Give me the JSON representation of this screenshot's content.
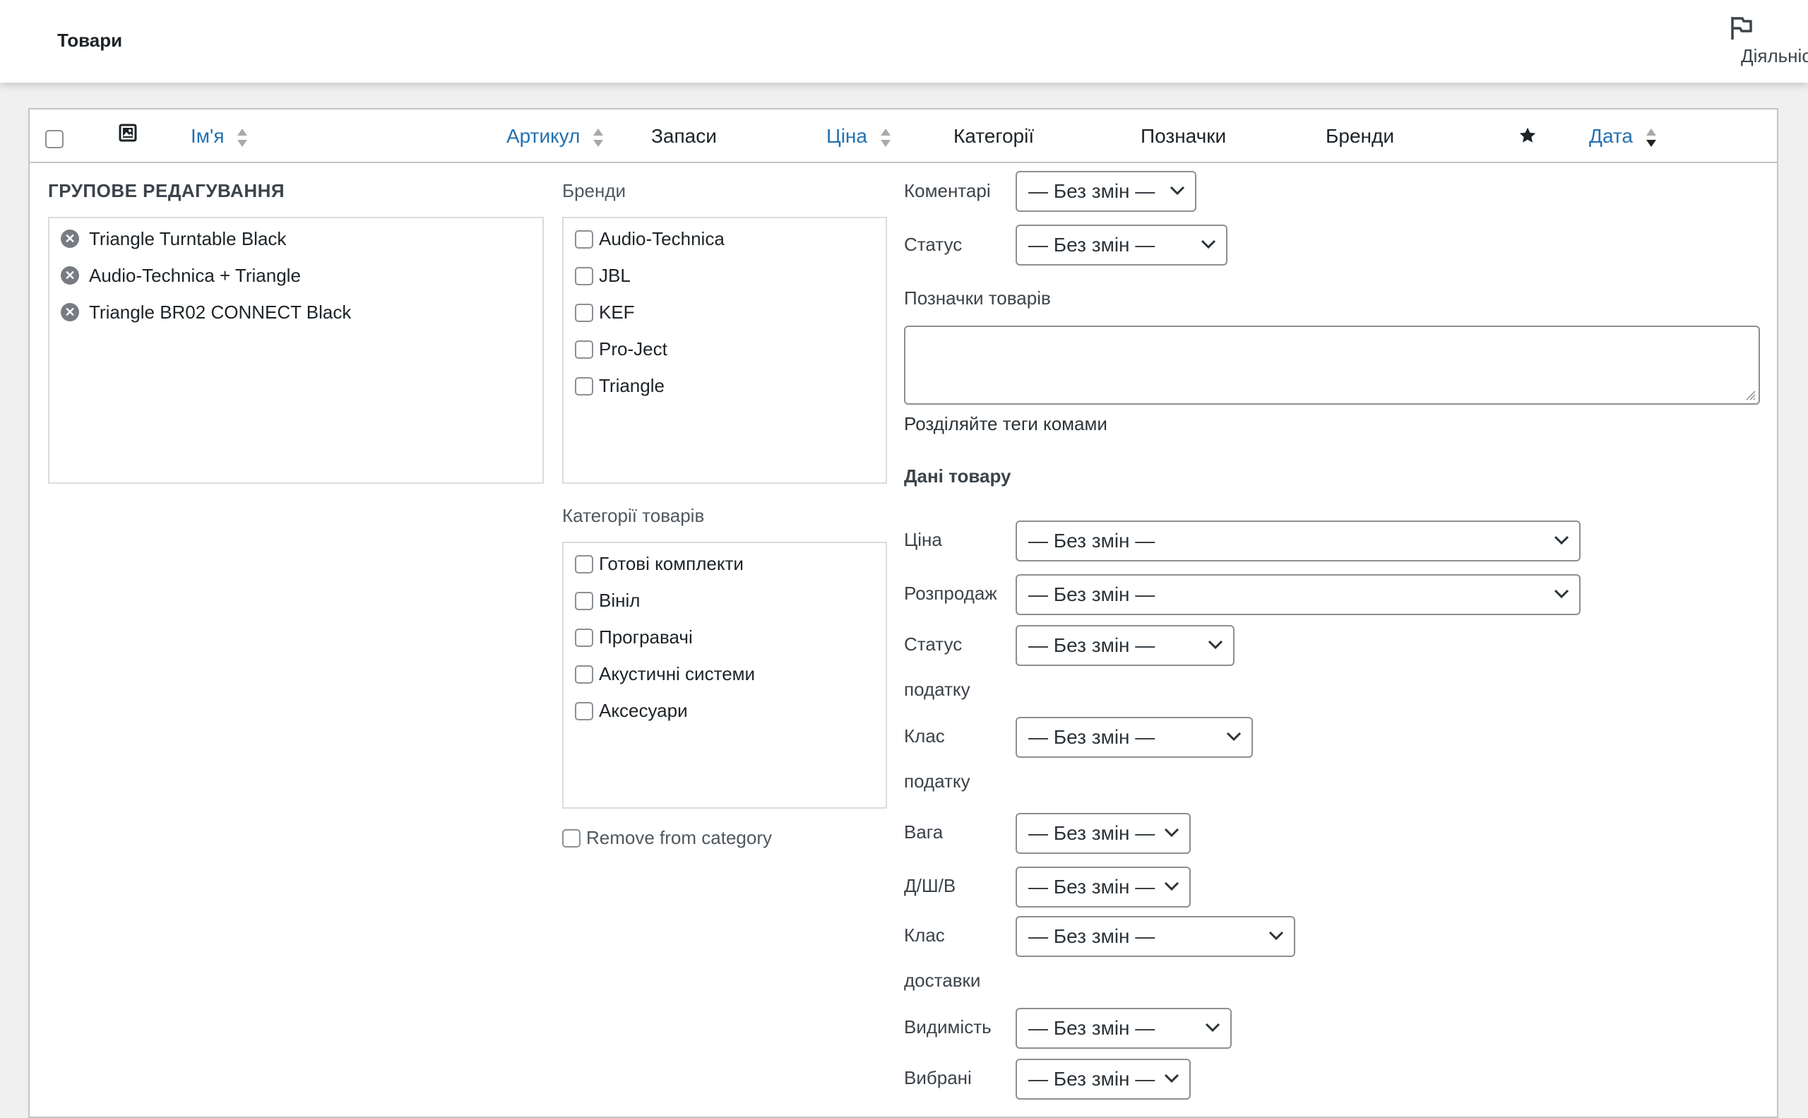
{
  "header": {
    "title": "Товари",
    "activity_label": "Діяльність"
  },
  "table": {
    "columns": {
      "name": "Ім'я",
      "sku": "Артикул",
      "stock": "Запаси",
      "price": "Ціна",
      "categories": "Категорії",
      "tags": "Позначки",
      "brands": "Бренди",
      "date": "Дата"
    }
  },
  "bulk_edit": {
    "title": "ГРУПОВЕ РЕДАГУВАННЯ",
    "products": [
      "Triangle Turntable Black",
      "Audio-Technica + Triangle",
      "Triangle BR02 CONNECT Black"
    ],
    "brands_label": "Бренди",
    "brands": [
      "Audio-Technica",
      "JBL",
      "KEF",
      "Pro-Ject",
      "Triangle"
    ],
    "categories_label": "Категорії товарів",
    "categories": [
      "Готові комплекти",
      "Вініл",
      "Програвачі",
      "Акустичні системи",
      "Аксесуари"
    ],
    "remove_from_category": "Remove from category",
    "comments_label": "Коментарі",
    "status_label": "Статус",
    "no_change": "— Без змін —",
    "tags_label": "Позначки товарів",
    "tags_hint": "Розділяйте теги комами",
    "product_data_title": "Дані товару",
    "price_label": "Ціна",
    "sale_label": "Розпродаж",
    "tax_status_label_1": "Статус",
    "tax_status_label_2": "податку",
    "tax_class_label_1": "Клас",
    "tax_class_label_2": "податку",
    "weight_label": "Вага",
    "dimensions_label": "Д/Ш/В",
    "shipping_class_label_1": "Клас",
    "shipping_class_label_2": "доставки",
    "visibility_label": "Видимість",
    "featured_label": "Вибрані"
  }
}
